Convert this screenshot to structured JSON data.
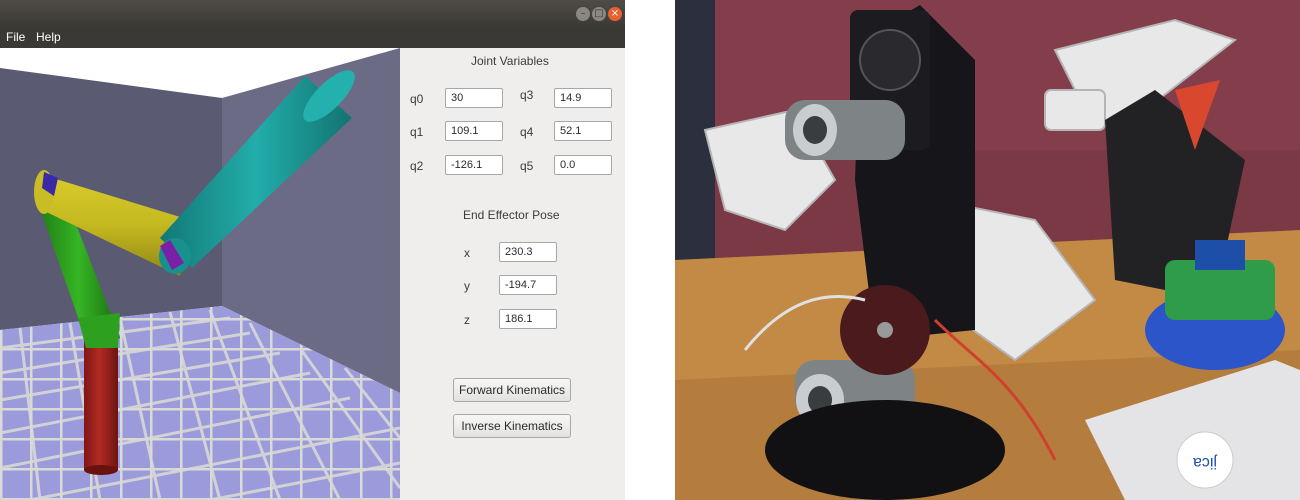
{
  "menu": {
    "file": "File",
    "help": "Help"
  },
  "window_controls": {
    "minimize": "–",
    "maximize": "□",
    "close": "×"
  },
  "joint_variables": {
    "heading": "Joint Variables",
    "joints": [
      {
        "label": "q0",
        "value": "30"
      },
      {
        "label": "q1",
        "value": "109.1"
      },
      {
        "label": "q2",
        "value": "-126.1"
      },
      {
        "label": "q3",
        "value": "14.9"
      },
      {
        "label": "q4",
        "value": "52.1"
      },
      {
        "label": "q5",
        "value": "0.0"
      }
    ]
  },
  "end_effector": {
    "heading": "End Effector Pose",
    "coords": [
      {
        "label": "x",
        "value": "230.3"
      },
      {
        "label": "y",
        "value": "-194.7"
      },
      {
        "label": "z",
        "value": "186.1"
      }
    ]
  },
  "buttons": {
    "forward": "Forward Kinematics",
    "inverse": "Inverse Kinematics"
  },
  "photo": {
    "sticker_text": "jica"
  },
  "colors": {
    "titlebar": "#3b3935",
    "panel": "#efeeec",
    "close_button": "#e9602f",
    "floor": "#9595d8",
    "back_wall": "#5a5a72",
    "link_red": "#a02521",
    "link_green": "#2fa31f",
    "link_yellow": "#c2b51f",
    "link_teal": "#1fa3a0"
  }
}
